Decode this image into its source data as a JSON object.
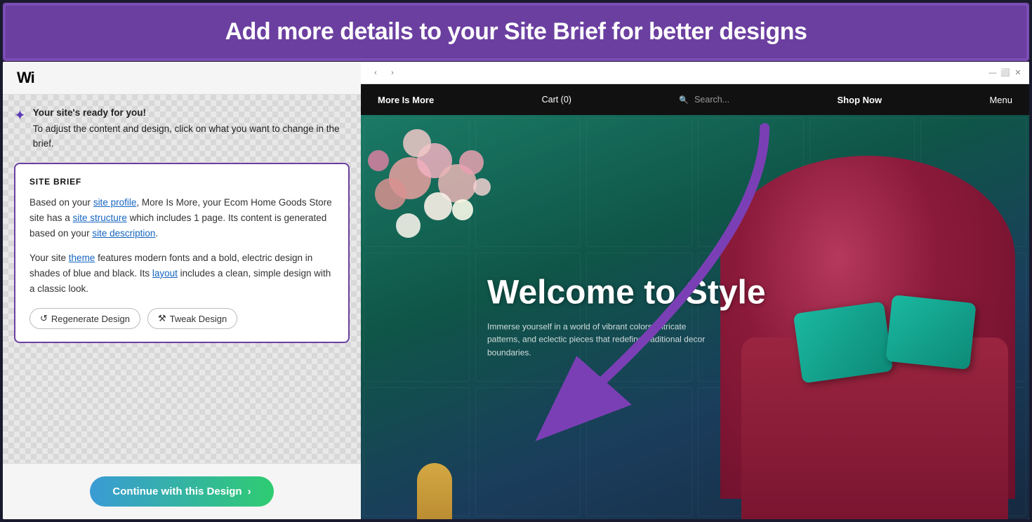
{
  "app": {
    "banner_text": "Add more details to your Site Brief for better designs"
  },
  "left_panel": {
    "logo": "Wi",
    "notice": {
      "title": "Your site's ready for you!",
      "body": "To adjust the content and design, click on what you want to change in the brief."
    },
    "brief": {
      "heading": "SITE BRIEF",
      "para1_before_link1": "Based on your ",
      "link1": "site profile",
      "para1_after_link1": ", More Is More, your Ecom Home Goods Store site has a ",
      "link2": "site structure",
      "para1_after_link2": " which includes 1 page. Its content is generated based on your ",
      "link3": "site description",
      "para1_end": ".",
      "para2_before_link4": "Your site ",
      "link4": "theme",
      "para2_after_link4": " features modern fonts and a bold, electric design in shades of blue and black. Its ",
      "link5": "layout",
      "para2_end": " includes a clean, simple design with a classic look.",
      "btn_regenerate": "Regenerate Design",
      "btn_tweak": "Tweak Design"
    },
    "continue_btn": "Continue with this Design"
  },
  "preview": {
    "nav": {
      "brand": "More Is More",
      "cart": "Cart (0)",
      "search_placeholder": "Search...",
      "shop_now": "Shop Now",
      "menu": "Menu"
    },
    "hero": {
      "title": "Welcome to Style",
      "subtitle": "Immerse yourself in a world of vibrant colors, intricate patterns, and eclectic pieces that redefine traditional decor boundaries."
    }
  },
  "icons": {
    "spark": "✦",
    "arrow_left": "‹",
    "arrow_right": "›",
    "search": "🔍",
    "regenerate": "↺",
    "tweak": "⚒",
    "chevron_right": "›",
    "minimize": "—",
    "restore": "⬜",
    "close": "✕"
  }
}
